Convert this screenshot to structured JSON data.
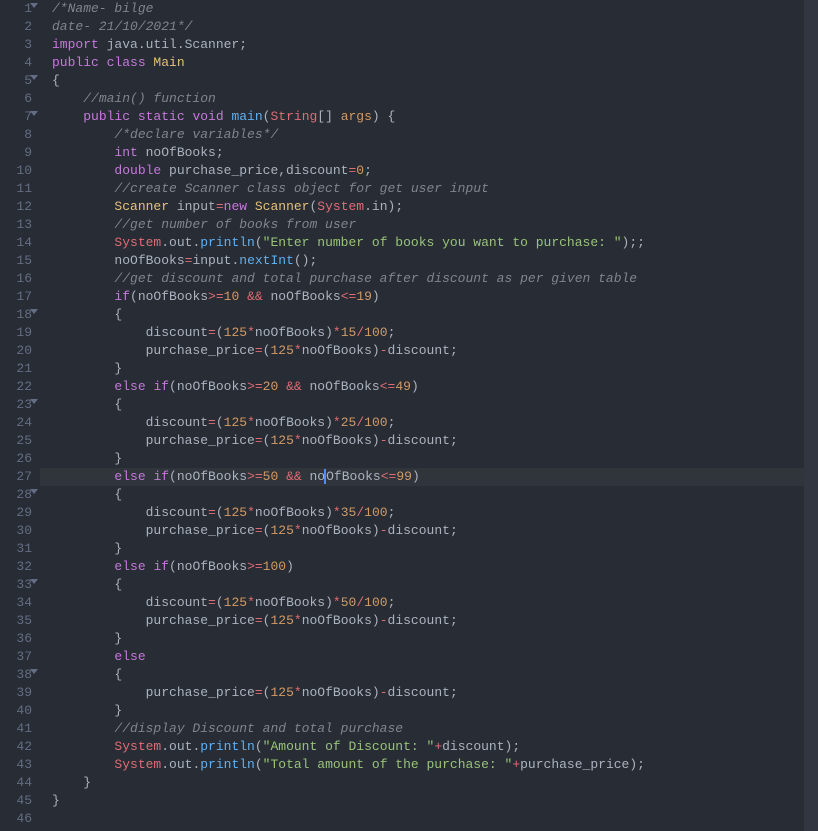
{
  "gutter": {
    "lines": [
      {
        "n": "1",
        "fold": true
      },
      {
        "n": "2",
        "fold": false
      },
      {
        "n": "3",
        "fold": false
      },
      {
        "n": "4",
        "fold": false
      },
      {
        "n": "5",
        "fold": true
      },
      {
        "n": "6",
        "fold": false
      },
      {
        "n": "7",
        "fold": true
      },
      {
        "n": "8",
        "fold": false
      },
      {
        "n": "9",
        "fold": false
      },
      {
        "n": "10",
        "fold": false
      },
      {
        "n": "11",
        "fold": false
      },
      {
        "n": "12",
        "fold": false
      },
      {
        "n": "13",
        "fold": false
      },
      {
        "n": "14",
        "fold": false
      },
      {
        "n": "15",
        "fold": false
      },
      {
        "n": "16",
        "fold": false
      },
      {
        "n": "17",
        "fold": false
      },
      {
        "n": "18",
        "fold": true
      },
      {
        "n": "19",
        "fold": false
      },
      {
        "n": "20",
        "fold": false
      },
      {
        "n": "21",
        "fold": false
      },
      {
        "n": "22",
        "fold": false
      },
      {
        "n": "23",
        "fold": true
      },
      {
        "n": "24",
        "fold": false
      },
      {
        "n": "25",
        "fold": false
      },
      {
        "n": "26",
        "fold": false
      },
      {
        "n": "27",
        "fold": false
      },
      {
        "n": "28",
        "fold": true
      },
      {
        "n": "29",
        "fold": false
      },
      {
        "n": "30",
        "fold": false
      },
      {
        "n": "31",
        "fold": false
      },
      {
        "n": "32",
        "fold": false
      },
      {
        "n": "33",
        "fold": true
      },
      {
        "n": "34",
        "fold": false
      },
      {
        "n": "35",
        "fold": false
      },
      {
        "n": "36",
        "fold": false
      },
      {
        "n": "37",
        "fold": false
      },
      {
        "n": "38",
        "fold": true
      },
      {
        "n": "39",
        "fold": false
      },
      {
        "n": "40",
        "fold": false
      },
      {
        "n": "41",
        "fold": false
      },
      {
        "n": "42",
        "fold": false
      },
      {
        "n": "43",
        "fold": false
      },
      {
        "n": "44",
        "fold": false
      },
      {
        "n": "45",
        "fold": false
      },
      {
        "n": "46",
        "fold": false
      }
    ]
  },
  "code": {
    "l1": {
      "c1": "/*Name- bilge"
    },
    "l2": {
      "c1": "date- 21/10/2021*/"
    },
    "l3": {
      "k1": "import",
      "t1": " java.util.Scanner;"
    },
    "l4": {
      "k1": "public",
      "k2": " class",
      "cl": " Main"
    },
    "l5": {
      "t": "{"
    },
    "l6": {
      "indent": "    ",
      "c1": "//main() function"
    },
    "l7": {
      "indent": "    ",
      "k1": "public",
      "k2": " static",
      "k3": " void",
      "fn": " main",
      "p1": "(",
      "ty": "String",
      "br": "[]",
      "arg": " args",
      "p2": ") {"
    },
    "l8": {
      "indent": "        ",
      "c1": "/*declare variables*/"
    },
    "l9": {
      "indent": "        ",
      "ty": "int",
      "v": " noOfBooks;"
    },
    "l10": {
      "indent": "        ",
      "ty": "double",
      "v1": " purchase_price,discount",
      "op": "=",
      "n": "0",
      "sc": ";"
    },
    "l11": {
      "indent": "        ",
      "c1": "//create Scanner class object for get user input"
    },
    "l12": {
      "indent": "        ",
      "cl1": "Scanner",
      "v1": " input",
      "op": "=",
      "k1": "new",
      "cl2": " Scanner",
      "p1": "(",
      "sys": "System",
      "v2": ".in);"
    },
    "l13": {
      "indent": "        ",
      "c1": "//get number of books from user"
    },
    "l14": {
      "indent": "        ",
      "sys": "System",
      "v1": ".out.",
      "fn": "println",
      "p1": "(",
      "s1": "\"Enter number of books you want to purchase: \"",
      "p2": ");;"
    },
    "l15": {
      "indent": "        ",
      "v1": "noOfBooks",
      "op": "=",
      "v2": "input.",
      "fn": "nextInt",
      "p": "();"
    },
    "l16": {
      "indent": "        ",
      "c1": "//get discount and total purchase after discount as per given table"
    },
    "l17": {
      "indent": "        ",
      "k1": "if",
      "p1": "(noOfBooks",
      "op1": ">=",
      "n1": "10",
      "op2": " && ",
      "v2": "noOfBooks",
      "op3": "<=",
      "n2": "19",
      "p2": ")"
    },
    "l18": {
      "indent": "        ",
      "t": "{"
    },
    "l19": {
      "indent": "            ",
      "v1": "discount",
      "op": "=",
      "p1": "(",
      "n1": "125",
      "op2": "*",
      "v2": "noOfBooks",
      "p2": ")",
      "op3": "*",
      "n2": "15",
      "op4": "/",
      "n3": "100",
      "sc": ";"
    },
    "l20": {
      "indent": "            ",
      "v1": "purchase_price",
      "op": "=",
      "p1": "(",
      "n1": "125",
      "op2": "*",
      "v2": "noOfBooks",
      "p2": ")",
      "op3": "-",
      "v3": "discount;"
    },
    "l21": {
      "indent": "        ",
      "t": "}"
    },
    "l22": {
      "indent": "        ",
      "k1": "else",
      "k2": " if",
      "p1": "(noOfBooks",
      "op1": ">=",
      "n1": "20",
      "op2": " && ",
      "v2": "noOfBooks",
      "op3": "<=",
      "n2": "49",
      "p2": ")"
    },
    "l23": {
      "indent": "        ",
      "t": "{"
    },
    "l24": {
      "indent": "            ",
      "v1": "discount",
      "op": "=",
      "p1": "(",
      "n1": "125",
      "op2": "*",
      "v2": "noOfBooks",
      "p2": ")",
      "op3": "*",
      "n2": "25",
      "op4": "/",
      "n3": "100",
      "sc": ";"
    },
    "l25": {
      "indent": "            ",
      "v1": "purchase_price",
      "op": "=",
      "p1": "(",
      "n1": "125",
      "op2": "*",
      "v2": "noOfBooks",
      "p2": ")",
      "op3": "-",
      "v3": "discount;"
    },
    "l26": {
      "indent": "        ",
      "t": "}"
    },
    "l27": {
      "indent": "        ",
      "k1": "else",
      "k2": " if",
      "p1": "(noOfBooks",
      "op1": ">=",
      "n1": "50",
      "op2": " && ",
      "v2a": "no",
      "v2b": "OfBooks",
      "op3": "<=",
      "n2": "99",
      "p2": ")"
    },
    "l28": {
      "indent": "        ",
      "t": "{"
    },
    "l29": {
      "indent": "            ",
      "v1": "discount",
      "op": "=",
      "p1": "(",
      "n1": "125",
      "op2": "*",
      "v2": "noOfBooks",
      "p2": ")",
      "op3": "*",
      "n2": "35",
      "op4": "/",
      "n3": "100",
      "sc": ";"
    },
    "l30": {
      "indent": "            ",
      "v1": "purchase_price",
      "op": "=",
      "p1": "(",
      "n1": "125",
      "op2": "*",
      "v2": "noOfBooks",
      "p2": ")",
      "op3": "-",
      "v3": "discount;"
    },
    "l31": {
      "indent": "        ",
      "t": "}"
    },
    "l32": {
      "indent": "        ",
      "k1": "else",
      "k2": " if",
      "p1": "(noOfBooks",
      "op1": ">=",
      "n1": "100",
      "p2": ")"
    },
    "l33": {
      "indent": "        ",
      "t": "{"
    },
    "l34": {
      "indent": "            ",
      "v1": "discount",
      "op": "=",
      "p1": "(",
      "n1": "125",
      "op2": "*",
      "v2": "noOfBooks",
      "p2": ")",
      "op3": "*",
      "n2": "50",
      "op4": "/",
      "n3": "100",
      "sc": ";"
    },
    "l35": {
      "indent": "            ",
      "v1": "purchase_price",
      "op": "=",
      "p1": "(",
      "n1": "125",
      "op2": "*",
      "v2": "noOfBooks",
      "p2": ")",
      "op3": "-",
      "v3": "discount;"
    },
    "l36": {
      "indent": "        ",
      "t": "}"
    },
    "l37": {
      "indent": "        ",
      "k1": "else"
    },
    "l38": {
      "indent": "        ",
      "t": "{"
    },
    "l39": {
      "indent": "            ",
      "v1": "purchase_price",
      "op": "=",
      "p1": "(",
      "n1": "125",
      "op2": "*",
      "v2": "noOfBooks",
      "p2": ")",
      "op3": "-",
      "v3": "discount;"
    },
    "l40": {
      "indent": "        ",
      "t": "}"
    },
    "l41": {
      "indent": "        ",
      "c1": "//display Discount and total purchase"
    },
    "l42": {
      "indent": "        ",
      "sys": "System",
      "v1": ".out.",
      "fn": "println",
      "p1": "(",
      "s1": "\"Amount of Discount: \"",
      "op": "+",
      "v2": "discount);"
    },
    "l43": {
      "indent": "        ",
      "sys": "System",
      "v1": ".out.",
      "fn": "println",
      "p1": "(",
      "s1": "\"Total amount of the purchase: \"",
      "op": "+",
      "v2": "purchase_price);"
    },
    "l44": {
      "indent": "    ",
      "t": "}"
    },
    "l45": {
      "t": "}"
    },
    "l46": {
      "t": ""
    }
  },
  "highlightedLine": 27
}
